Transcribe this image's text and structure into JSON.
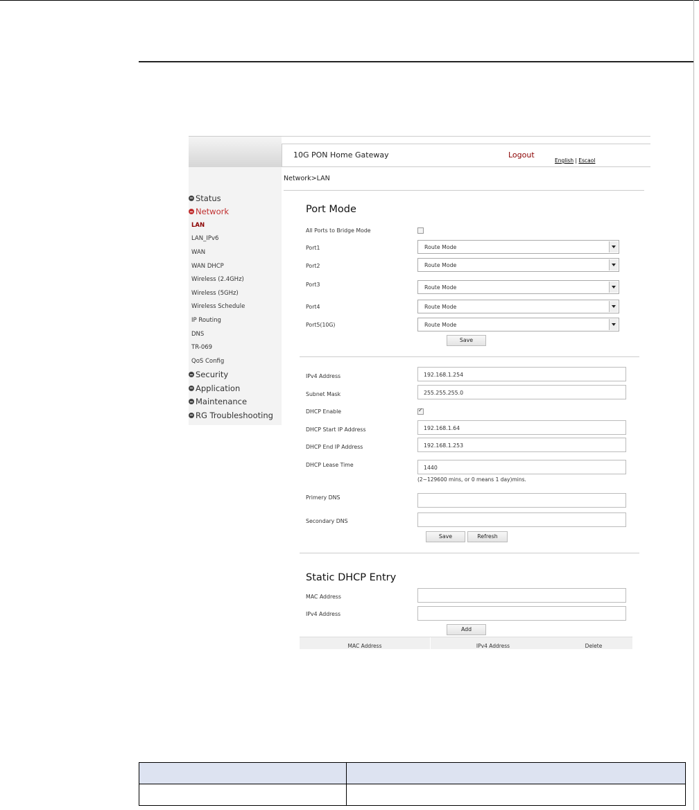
{
  "header": {
    "brand": "10G PON Home Gateway",
    "logout": "Logout",
    "lang_en": "English",
    "lang_sep": "|",
    "lang_es": "Escaol"
  },
  "breadcrumb": "Network>LAN",
  "nav": {
    "status": "Status",
    "network": "Network",
    "network_items": [
      "LAN",
      "LAN_IPv6",
      "WAN",
      "WAN DHCP",
      "Wireless (2.4GHz)",
      "Wireless (5GHz)",
      "Wireless Schedule",
      "IP Routing",
      "DNS",
      "TR-069",
      "QoS Config"
    ],
    "security": "Security",
    "application": "Application",
    "maintenance": "Maintenance",
    "troubleshooting": "RG Troubleshooting"
  },
  "port_mode": {
    "title": "Port Mode",
    "bridge_label": "All Ports to Bridge Mode",
    "bridge_checked": false,
    "ports": [
      {
        "label": "Port1",
        "value": "Route Mode"
      },
      {
        "label": "Port2",
        "value": "Route Mode"
      },
      {
        "label": "Port3",
        "value": "Route Mode"
      },
      {
        "label": "Port4",
        "value": "Route Mode"
      },
      {
        "label": "Port5(10G)",
        "value": "Route Mode"
      }
    ],
    "save": "Save"
  },
  "lan": {
    "ipv4_label": "IPv4 Address",
    "ipv4_value": "192.168.1.254",
    "mask_label": "Subnet Mask",
    "mask_value": "255.255.255.0",
    "dhcp_label": "DHCP Enable",
    "dhcp_checked": true,
    "start_label": "DHCP Start IP Address",
    "start_value": "192.168.1.64",
    "end_label": "DHCP End IP Address",
    "end_value": "192.168.1.253",
    "lease_label": "DHCP Lease Time",
    "lease_value": "1440",
    "lease_note": "(2~129600 mins, or 0 means 1 day)mins.",
    "pdns_label": "Primery DNS",
    "pdns_value": "",
    "sdns_label": "Secondary DNS",
    "sdns_value": "",
    "save": "Save",
    "refresh": "Refresh"
  },
  "static_dhcp": {
    "title": "Static DHCP Entry",
    "mac_label": "MAC Address",
    "mac_value": "",
    "ip_label": "IPv4 Address",
    "ip_value": "",
    "add": "Add",
    "columns": [
      "MAC Address",
      "IPv4 Address",
      "Delete"
    ]
  },
  "doc_table": {
    "header": [
      "",
      ""
    ],
    "row": [
      "",
      ""
    ]
  },
  "colors": {
    "accent": "#8b0000",
    "nav_active": "#c03030",
    "table_header": "#dde3f1"
  }
}
